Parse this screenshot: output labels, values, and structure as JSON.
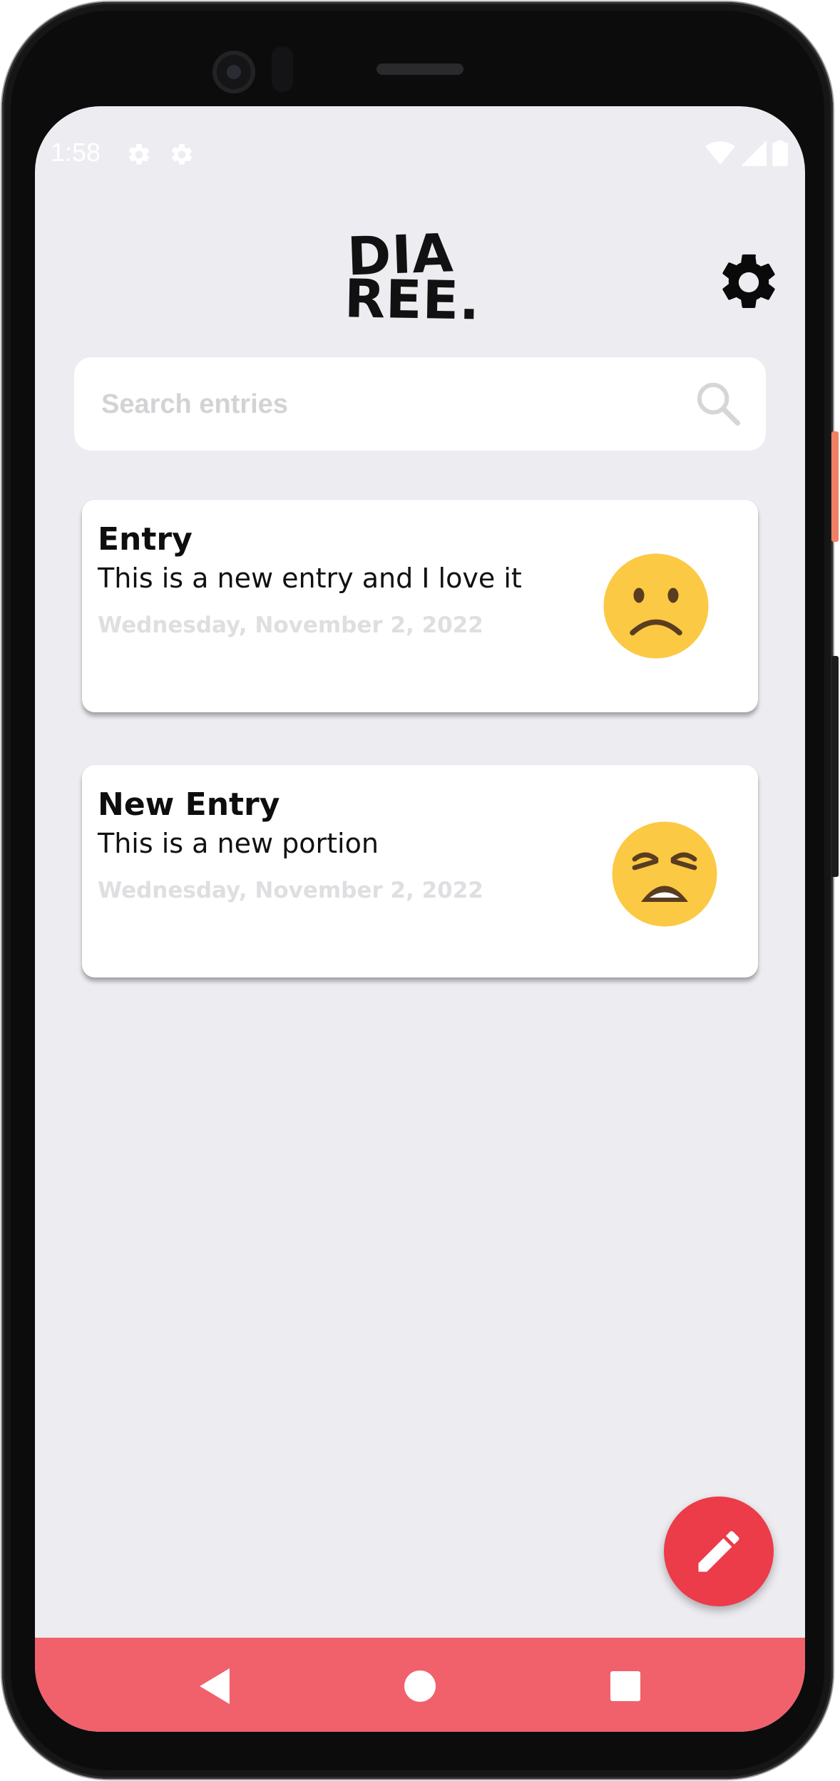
{
  "status_bar": {
    "time": "1:58",
    "icons": [
      "gear-icon",
      "gear-icon",
      "wifi-icon",
      "signal-icon",
      "battery-icon"
    ]
  },
  "header": {
    "logo_line1": "DIA",
    "logo_line2": "REE.",
    "settings_icon": "gear-icon"
  },
  "search": {
    "placeholder": "Search entries",
    "value": "",
    "icon": "search-icon"
  },
  "entries": [
    {
      "title": "Entry",
      "body": "This is a new entry and I love it",
      "date": "Wednesday, November 2, 2022",
      "mood_icon": "frowning-face-icon"
    },
    {
      "title": "New Entry",
      "body": "This is a new portion",
      "date": "Wednesday, November 2, 2022",
      "mood_icon": "weary-face-icon"
    }
  ],
  "fab": {
    "icon": "pencil-icon"
  },
  "nav": {
    "back": "back-icon",
    "home": "home-icon",
    "recents": "recents-icon"
  },
  "colors": {
    "background": "#edecf1",
    "card": "#ffffff",
    "fab": "#ec3b49",
    "nav_bar": "#f0616c",
    "date_text": "#dfdfe2",
    "emoji_yellow": "#fbc943"
  }
}
